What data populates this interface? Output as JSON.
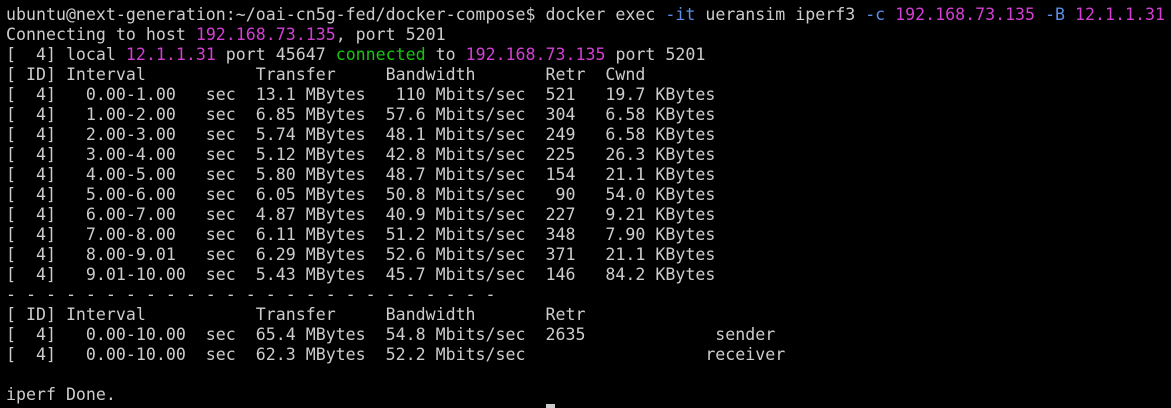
{
  "colors": {
    "background": "#000000",
    "text": "#cccccc",
    "host_ip": "#d33fd3",
    "option": "#5a8fe6",
    "status_connected": "#16c60c"
  },
  "terminal": {
    "lines": [
      {
        "segments": [
          {
            "text": "ubuntu@next-generation:~/oai-cn5g-fed/docker-compose$ docker exec ",
            "color": "text"
          },
          {
            "text": "-it",
            "color": "option"
          },
          {
            "text": " ueransim iperf3 ",
            "color": "text"
          },
          {
            "text": "-c",
            "color": "option"
          },
          {
            "text": " ",
            "color": "text"
          },
          {
            "text": "192.168.73.135",
            "color": "host_ip"
          },
          {
            "text": " ",
            "color": "text"
          },
          {
            "text": "-B",
            "color": "option"
          },
          {
            "text": " ",
            "color": "text"
          },
          {
            "text": "12.1.1.31",
            "color": "host_ip"
          }
        ]
      },
      {
        "segments": [
          {
            "text": "Connecting to host ",
            "color": "text"
          },
          {
            "text": "192.168.73.135",
            "color": "host_ip"
          },
          {
            "text": ", port 5201",
            "color": "text"
          }
        ]
      },
      {
        "segments": [
          {
            "text": "[  4] local ",
            "color": "text"
          },
          {
            "text": "12.1.1.31",
            "color": "host_ip"
          },
          {
            "text": " port 45647 ",
            "color": "text"
          },
          {
            "text": "connected",
            "color": "status_connected"
          },
          {
            "text": " to ",
            "color": "text"
          },
          {
            "text": "192.168.73.135",
            "color": "host_ip"
          },
          {
            "text": " port 5201",
            "color": "text"
          }
        ]
      },
      {
        "segments": [
          {
            "text": "[ ID] Interval           Transfer     Bandwidth       Retr  Cwnd",
            "color": "text"
          }
        ]
      },
      {
        "segments": [
          {
            "text": "[  4]   0.00-1.00   sec  13.1 MBytes   110 Mbits/sec  521   19.7 KBytes",
            "color": "text"
          }
        ]
      },
      {
        "segments": [
          {
            "text": "[  4]   1.00-2.00   sec  6.85 MBytes  57.6 Mbits/sec  304   6.58 KBytes",
            "color": "text"
          }
        ]
      },
      {
        "segments": [
          {
            "text": "[  4]   2.00-3.00   sec  5.74 MBytes  48.1 Mbits/sec  249   6.58 KBytes",
            "color": "text"
          }
        ]
      },
      {
        "segments": [
          {
            "text": "[  4]   3.00-4.00   sec  5.12 MBytes  42.8 Mbits/sec  225   26.3 KBytes",
            "color": "text"
          }
        ]
      },
      {
        "segments": [
          {
            "text": "[  4]   4.00-5.00   sec  5.80 MBytes  48.7 Mbits/sec  154   21.1 KBytes",
            "color": "text"
          }
        ]
      },
      {
        "segments": [
          {
            "text": "[  4]   5.00-6.00   sec  6.05 MBytes  50.8 Mbits/sec   90   54.0 KBytes",
            "color": "text"
          }
        ]
      },
      {
        "segments": [
          {
            "text": "[  4]   6.00-7.00   sec  4.87 MBytes  40.9 Mbits/sec  227   9.21 KBytes",
            "color": "text"
          }
        ]
      },
      {
        "segments": [
          {
            "text": "[  4]   7.00-8.00   sec  6.11 MBytes  51.2 Mbits/sec  348   7.90 KBytes",
            "color": "text"
          }
        ]
      },
      {
        "segments": [
          {
            "text": "[  4]   8.00-9.01   sec  6.29 MBytes  52.6 Mbits/sec  371   21.1 KBytes",
            "color": "text"
          }
        ]
      },
      {
        "segments": [
          {
            "text": "[  4]   9.01-10.00  sec  5.43 MBytes  45.7 Mbits/sec  146   84.2 KBytes",
            "color": "text"
          }
        ]
      },
      {
        "segments": [
          {
            "text": "- - - - - - - - - - - - - - - - - - - - - - - - -",
            "color": "text"
          }
        ]
      },
      {
        "segments": [
          {
            "text": "[ ID] Interval           Transfer     Bandwidth       Retr",
            "color": "text"
          }
        ]
      },
      {
        "segments": [
          {
            "text": "[  4]   0.00-10.00  sec  65.4 MBytes  54.8 Mbits/sec  2635             sender",
            "color": "text"
          }
        ]
      },
      {
        "segments": [
          {
            "text": "[  4]   0.00-10.00  sec  62.3 MBytes  52.2 Mbits/sec                  receiver",
            "color": "text"
          }
        ]
      },
      {
        "segments": [
          {
            "text": "",
            "color": "text"
          }
        ]
      },
      {
        "segments": [
          {
            "text": "iperf Done.",
            "color": "text"
          }
        ]
      }
    ]
  }
}
